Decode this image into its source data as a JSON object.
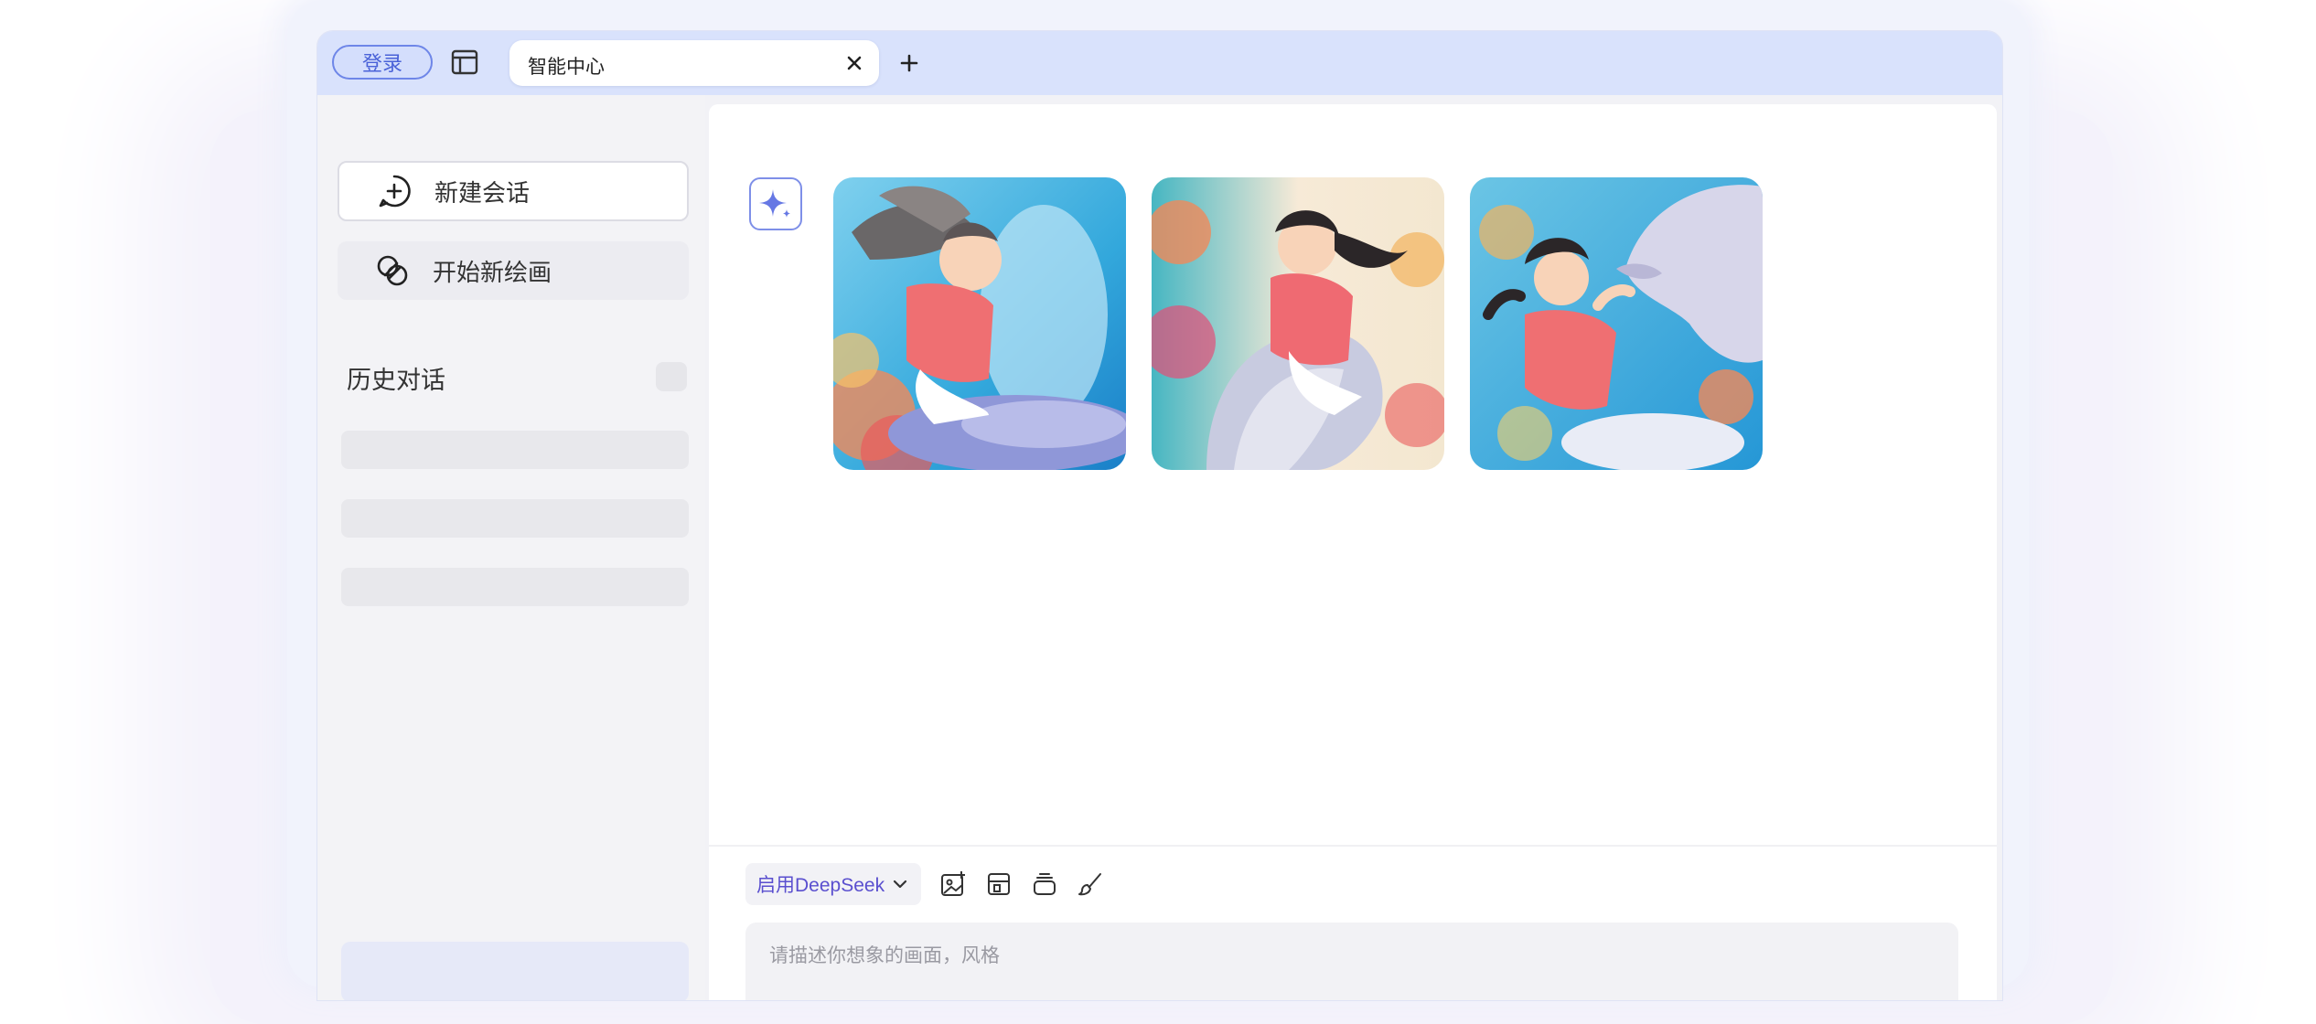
{
  "titlebar": {
    "login_label": "登录",
    "tabs": [
      {
        "label": "智能中心"
      }
    ]
  },
  "sidebar": {
    "actions": [
      {
        "label": "新建会话",
        "icon": "chat-add-icon"
      },
      {
        "label": "开始新绘画",
        "icon": "link-draw-icon"
      }
    ],
    "history_title": "历史对话"
  },
  "main": {
    "assistant_icon": "sparkle-icon",
    "images": [
      {
        "name": "generated-image-1",
        "subject": "girl riding dolphin"
      },
      {
        "name": "generated-image-2",
        "subject": "girl riding dolphin"
      },
      {
        "name": "generated-image-3",
        "subject": "girl with dolphin"
      }
    ],
    "composer": {
      "model_label": "启用DeepSeek",
      "tools": [
        "image-add-icon",
        "layout-icon",
        "layers-icon",
        "brush-icon"
      ],
      "placeholder": "请描述你想象的画面，风格"
    }
  },
  "colors": {
    "accent": "#4a62d8",
    "titlebar": "#d9e2fc",
    "model_text": "#5a4fcf"
  }
}
